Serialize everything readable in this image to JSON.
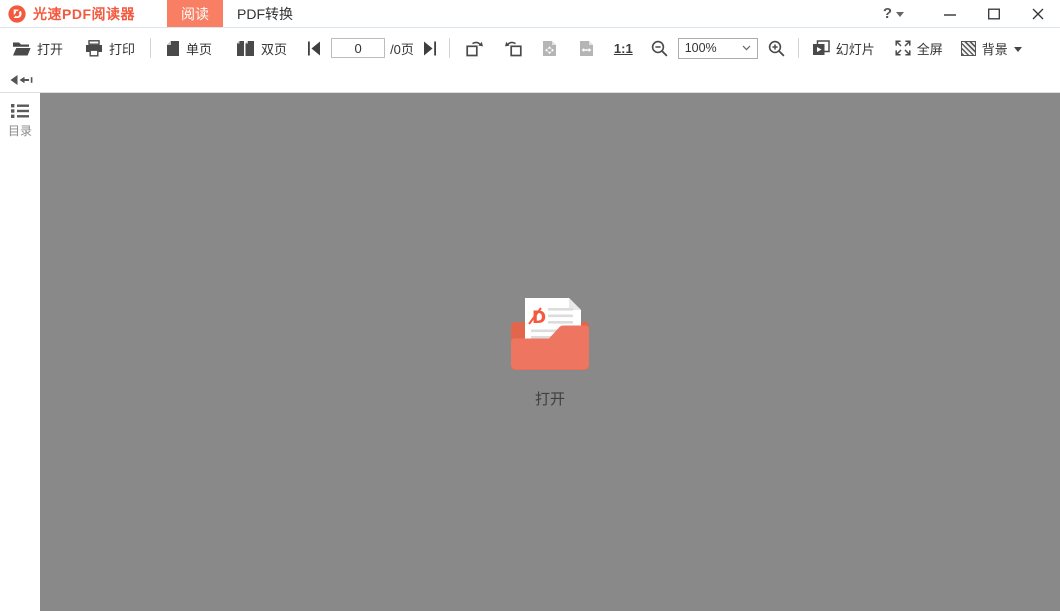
{
  "colors": {
    "accent": "#f4583e",
    "tab-active-bg": "#f87f63",
    "canvas-bg": "#898989",
    "folder-front": "#ee7660",
    "folder-back": "#e2664b"
  },
  "titlebar": {
    "app_title": "光速PDF阅读器",
    "help_label": "?",
    "tabs": [
      {
        "label": "阅读",
        "active": true
      },
      {
        "label": "PDF转换",
        "active": false
      }
    ]
  },
  "toolbar": {
    "open": "打开",
    "print": "打印",
    "single_page": "单页",
    "double_page": "双页",
    "page_input": "0",
    "page_total": "/0页",
    "actual_size": "1:1",
    "zoom_level": "100%",
    "slideshow": "幻灯片",
    "fullscreen": "全屏",
    "background": "背景"
  },
  "sidebar": {
    "toc": "目录"
  },
  "canvas": {
    "open_prompt": "打开"
  }
}
